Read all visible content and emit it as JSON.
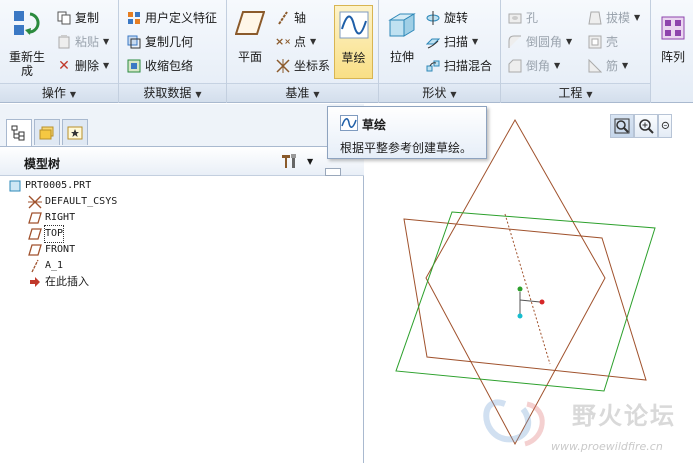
{
  "ribbon": {
    "groups": {
      "operations": {
        "title": "操作",
        "regenerate": "重新生\n成",
        "copy": "复制",
        "paste": "粘贴",
        "delete": "删除"
      },
      "get_data": {
        "title": "获取数据",
        "udf": "用户定义特征",
        "copy_geometry": "复制几何",
        "shrinkwrap": "收缩包络"
      },
      "datum": {
        "title": "基准",
        "plane": "平面",
        "axis": "轴",
        "point": "点",
        "csys": "坐标系",
        "sketch": "草绘"
      },
      "shapes": {
        "title": "形状",
        "extrude": "拉伸",
        "revolve": "旋转",
        "sweep": "扫描",
        "swept_blend": "扫描混合"
      },
      "engineering": {
        "title": "工程",
        "hole": "孔",
        "round": "倒圆角",
        "chamfer": "倒角",
        "draft": "拔模",
        "shell": "壳",
        "rib": "筋"
      },
      "pattern": {
        "label": "阵列"
      }
    }
  },
  "tooltip": {
    "title": "草绘",
    "description": "根据平整参考创建草绘。"
  },
  "model_tree": {
    "title": "模型树",
    "items": [
      {
        "label": "PRT0005.PRT",
        "icon": "part-icon"
      },
      {
        "label": "DEFAULT_CSYS",
        "icon": "csys-icon"
      },
      {
        "label": "RIGHT",
        "icon": "datum-plane-icon"
      },
      {
        "label": "TOP",
        "icon": "datum-plane-icon"
      },
      {
        "label": "FRONT",
        "icon": "datum-plane-icon"
      },
      {
        "label": "A_1",
        "icon": "datum-axis-icon"
      },
      {
        "label": "在此插入",
        "icon": "insert-here-arrow-icon"
      }
    ]
  },
  "graphics": {
    "watermark_text": "野火论坛",
    "watermark_url": "www.proewildfire.cn",
    "plane_colors": {
      "right_front": "#a0522d",
      "top": "#2ca02c"
    }
  },
  "colors": {
    "ribbon_bg": "#e4ecf6",
    "highlight": "#f9df86",
    "border": "#a9b9cf"
  }
}
